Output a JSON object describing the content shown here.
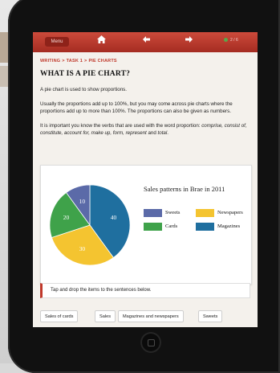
{
  "nav": {
    "menu_label": "Menu",
    "page_indicator": "2 / 6"
  },
  "breadcrumb": {
    "section": "WRITING",
    "task": "TASK 1",
    "page": "PIE CHARTS"
  },
  "page_title": "WHAT IS A PIE CHART?",
  "paragraphs": {
    "p1": "A pie chart is used to show proportions.",
    "p2": "Usually the proportions add up to 100%, but you may come across pie charts where the proportions add up to more than 100%. The proportions can also be given as numbers.",
    "p3_lead": "It is important you know the verbs that are used with the word proportion: ",
    "p3_verbs": "comprise, consist of, constitute, account for, make up, form, represent",
    "p3_and": " and ",
    "p3_last": "total",
    "p3_end": "."
  },
  "chart_data": {
    "type": "pie",
    "title": "Sales patterns in Brae in 2011",
    "slices": [
      {
        "label": "Sweets",
        "value": 10,
        "color": "#5b6aa8"
      },
      {
        "label": "Cards",
        "value": 20,
        "color": "#3fa24a"
      },
      {
        "label": "Newspapers",
        "value": 30,
        "color": "#f4c430"
      },
      {
        "label": "Magazines",
        "value": 40,
        "color": "#1f6f9f"
      }
    ],
    "legend_order": [
      "Sweets",
      "Newspapers",
      "Cards",
      "Magazines"
    ]
  },
  "instruction": "Tap and drop the items to the sentences below.",
  "drag_items": [
    "Sales of cards",
    "Sales",
    "Magazines and newspapers",
    "Sweets"
  ],
  "colors": {
    "accent": "#c0392b",
    "topbar": "#b8342a"
  }
}
